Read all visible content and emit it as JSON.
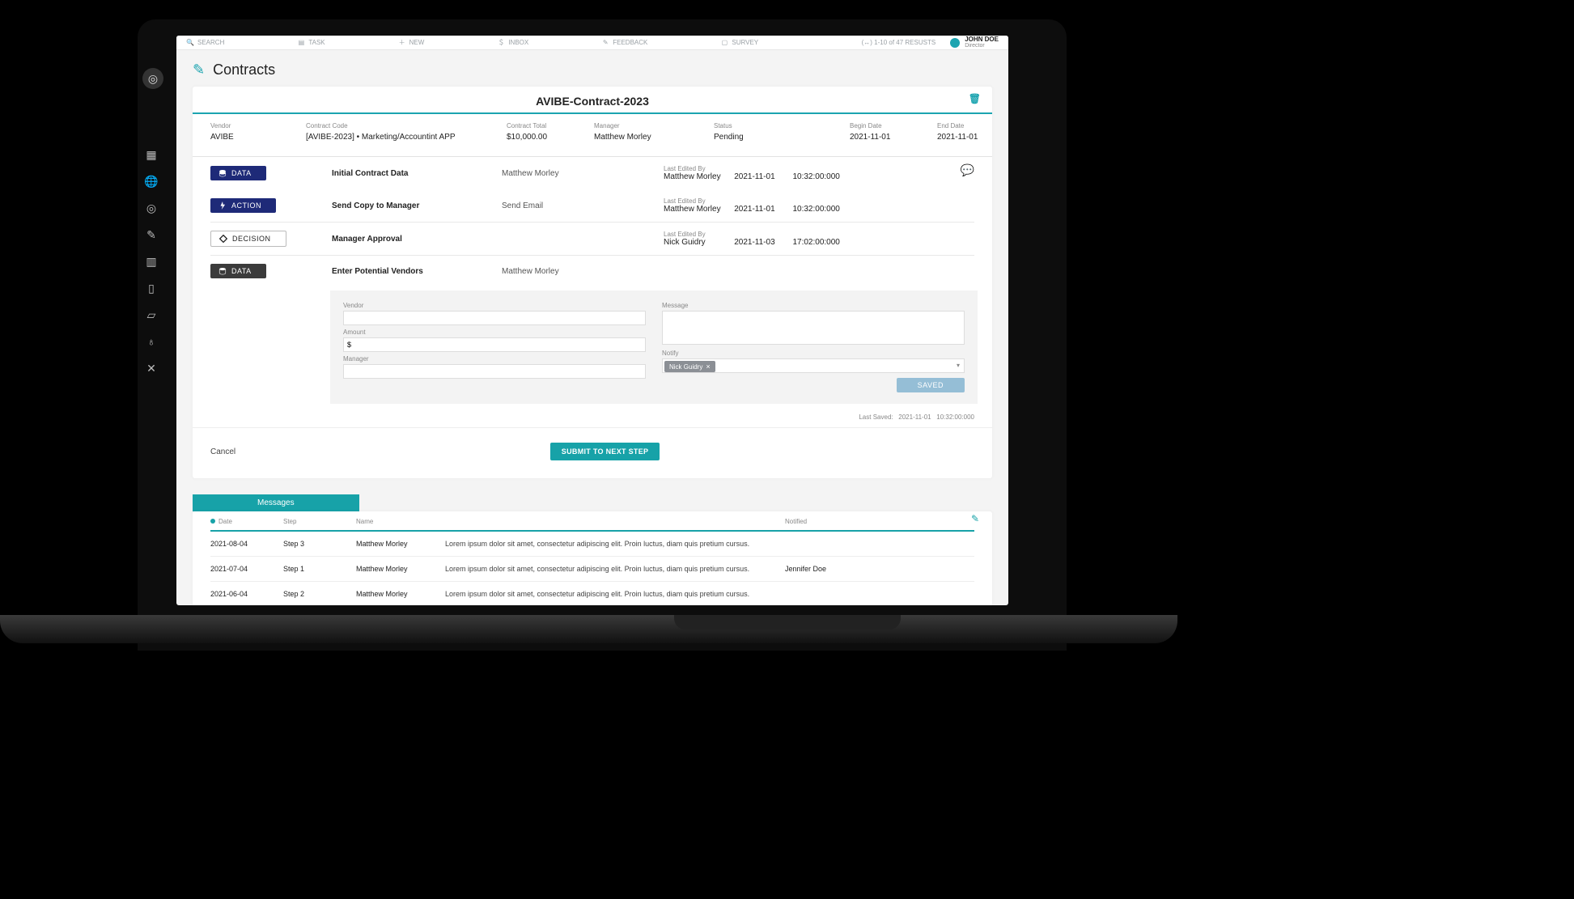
{
  "topnav": {
    "search": "SEARCH",
    "task": "TASK",
    "new": "NEW",
    "inbox": "INBOX",
    "feedback": "FEEDBACK",
    "survey": "SURVEY",
    "pagecount": "1-10 of 47 RESUSTS"
  },
  "user": {
    "name": "JOHN DOE",
    "role": "Director"
  },
  "page": {
    "title": "Contracts"
  },
  "contract": {
    "title": "AVIBE-Contract-2023",
    "labels": {
      "vendor": "Vendor",
      "code": "Contract Code",
      "total": "Contract Total",
      "manager": "Manager",
      "status": "Status",
      "begin": "Begin Date",
      "end": "End Date"
    },
    "vendor": "AVIBE",
    "code": "[AVIBE-2023] • Marketing/Accountint APP",
    "total": "$10,000.00",
    "manager": "Matthew Morley",
    "status": "Pending",
    "begin": "2021-11-01",
    "end": "2021-11-01"
  },
  "badges": {
    "data": "DATA",
    "action": "ACTION",
    "decision": "DECISION"
  },
  "steps": [
    {
      "title": "Initial Contract Data",
      "sub": "Matthew Morley",
      "editedLabel": "Last Edited By",
      "editedBy": "Matthew Morley",
      "date": "2021-11-01",
      "time": "10:32:00:000"
    },
    {
      "title": "Send Copy to Manager",
      "sub": "Send Email",
      "editedLabel": "Last Edited By",
      "editedBy": "Matthew Morley",
      "date": "2021-11-01",
      "time": "10:32:00:000"
    },
    {
      "title": "Manager Approval",
      "sub": "",
      "editedLabel": "Last Edited By",
      "editedBy": "Nick Guidry",
      "date": "2021-11-03",
      "time": "17:02:00:000"
    },
    {
      "title": "Enter Potential Vendors",
      "sub": "Matthew Morley"
    }
  ],
  "form": {
    "labels": {
      "vendor": "Vendor",
      "message": "Message",
      "amount": "Amount",
      "manager": "Manager",
      "notify": "Notify"
    },
    "amountPrefix": "$",
    "notifyTag": "Nick Guidry",
    "savedBtn": "SAVED",
    "lastSavedLabel": "Last Saved:",
    "lastSavedDate": "2021-11-01",
    "lastSavedTime": "10:32:00:000"
  },
  "actions": {
    "cancel": "Cancel",
    "submit": "SUBMIT TO NEXT STEP"
  },
  "messages": {
    "tab": "Messages",
    "headers": {
      "date": "Date",
      "step": "Step",
      "name": "Name",
      "notified": "Notified"
    },
    "rows": [
      {
        "date": "2021-08-04",
        "step": "Step 3",
        "name": "Matthew Morley",
        "text": "Lorem ipsum dolor sit amet, consectetur adipiscing elit. Proin luctus, diam quis pretium cursus.",
        "notified": ""
      },
      {
        "date": "2021-07-04",
        "step": "Step 1",
        "name": "Matthew Morley",
        "text": "Lorem ipsum dolor sit amet, consectetur adipiscing elit. Proin luctus, diam quis pretium cursus.",
        "notified": "Jennifer Doe"
      },
      {
        "date": "2021-06-04",
        "step": "Step 2",
        "name": "Matthew Morley",
        "text": "Lorem ipsum dolor sit amet, consectetur adipiscing elit. Proin luctus, diam quis pretium cursus.",
        "notified": ""
      }
    ]
  }
}
